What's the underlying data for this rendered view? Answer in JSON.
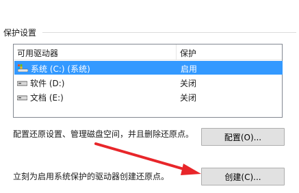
{
  "protection": {
    "group_title": "保护设置",
    "columns": {
      "name": "可用驱动器",
      "protection": "保护"
    },
    "drives": [
      {
        "name": "系统 (C:) (系统)",
        "protection": "启用",
        "selected": true,
        "icon": "system-drive-icon"
      },
      {
        "name": "软件 (D:)",
        "protection": "关闭",
        "selected": false,
        "icon": "drive-icon"
      },
      {
        "name": "文档 (E:)",
        "protection": "关闭",
        "selected": false,
        "icon": "drive-icon"
      }
    ],
    "configure_text": "配置还原设置、管理磁盘空间，并且删除还原点。",
    "configure_button": "配置(O)...",
    "create_text": "立刻为启用系统保护的驱动器创建还原点。",
    "create_button": "创建(C)..."
  },
  "colors": {
    "selection": "#3399ff",
    "annotation_arrow": "#e8262a"
  }
}
